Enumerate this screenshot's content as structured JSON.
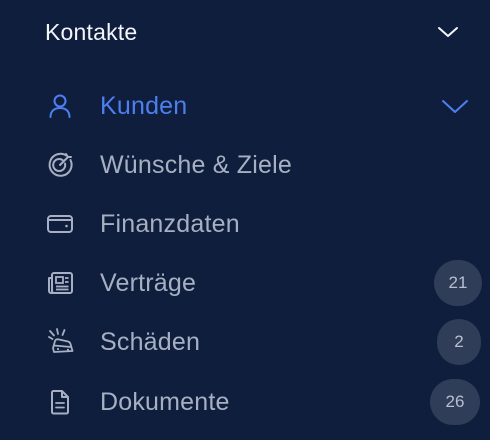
{
  "section": {
    "title": "Kontakte",
    "chevron_icon": "chevron-down-icon"
  },
  "colors": {
    "background": "#0f1e3d",
    "active": "#4d7ff0",
    "text": "#a7b0c2",
    "header_text": "#f3f5f9",
    "badge_bg": "#2f3d58"
  },
  "nav": {
    "items": [
      {
        "label": "Kunden",
        "icon": "user-icon",
        "active": true,
        "expand_icon": "chevron-down-icon"
      },
      {
        "label": "Wünsche & Ziele",
        "icon": "target-icon"
      },
      {
        "label": "Finanzdaten",
        "icon": "wallet-icon"
      },
      {
        "label": "Verträge",
        "icon": "contract-icon",
        "badge": "21"
      },
      {
        "label": "Schäden",
        "icon": "car-damage-icon",
        "badge": "2"
      },
      {
        "label": "Dokumente",
        "icon": "document-icon",
        "badge": "26"
      }
    ]
  }
}
